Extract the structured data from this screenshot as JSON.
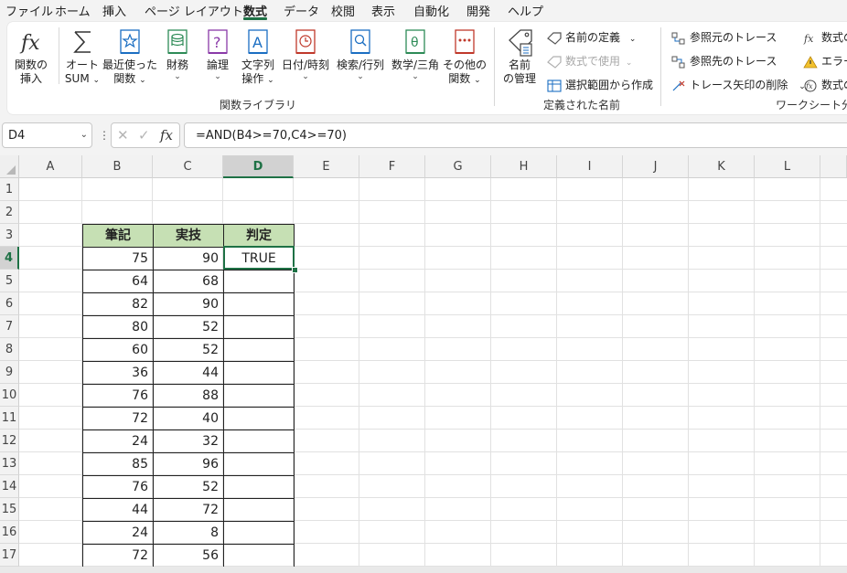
{
  "menu": {
    "items": [
      "ファイル",
      "ホーム",
      "挿入",
      "ページ レイアウト",
      "数式",
      "データ",
      "校閲",
      "表示",
      "自動化",
      "開発",
      "ヘルプ"
    ],
    "active_index": 4
  },
  "ribbon": {
    "function_library": {
      "buttons": [
        {
          "line1": "関数の",
          "line2": "挿入",
          "icon": "fx-icon"
        },
        {
          "line1": "オート",
          "line2": "SUM",
          "icon": "sigma-icon"
        },
        {
          "line1": "最近使った",
          "line2": "関数",
          "icon": "star-book-icon"
        },
        {
          "line1": "財務",
          "line2": "",
          "icon": "coins-book-icon"
        },
        {
          "line1": "論理",
          "line2": "",
          "icon": "question-book-icon"
        },
        {
          "line1": "文字列",
          "line2": "操作",
          "icon": "letter-a-book-icon"
        },
        {
          "line1": "日付/時刻",
          "line2": "",
          "icon": "clock-book-icon"
        },
        {
          "line1": "検索/行列",
          "line2": "",
          "icon": "magnifier-book-icon"
        },
        {
          "line1": "数学/三角",
          "line2": "",
          "icon": "theta-book-icon"
        },
        {
          "line1": "その他の",
          "line2": "関数",
          "icon": "more-book-icon"
        }
      ],
      "label": "関数ライブラリ"
    },
    "defined_names": {
      "name_manager": {
        "line1": "名前",
        "line2": "の管理"
      },
      "define_name": "名前の定義",
      "use_in_formula": "数式で使用",
      "create_from_selection": "選択範囲から作成",
      "label": "定義された名前"
    },
    "formula_auditing": {
      "trace_precedents": "参照元のトレース",
      "trace_dependents": "参照先のトレース",
      "remove_arrows": "トレース矢印の削除",
      "show_formulas": "数式の",
      "error_checking": "エラー",
      "evaluate_formula": "数式の",
      "label": "ワークシート分析"
    }
  },
  "formula_bar": {
    "name_box": "D4",
    "formula": "=AND(B4>=70,C4>=70)",
    "cancel_glyph": "✕",
    "enter_glyph": "✓",
    "fx_glyph": "fx"
  },
  "sheet": {
    "columns": [
      "A",
      "B",
      "C",
      "D",
      "E",
      "F",
      "G",
      "H",
      "I",
      "J",
      "K",
      "L"
    ],
    "rows": [
      "1",
      "2",
      "3",
      "4",
      "5",
      "6",
      "7",
      "8",
      "9",
      "10",
      "11",
      "12",
      "13",
      "14",
      "15",
      "16",
      "17"
    ],
    "selected_column": "D",
    "selected_row": "4",
    "table": {
      "headers": [
        "筆記",
        "実技",
        "判定"
      ],
      "rows": [
        [
          "75",
          "90",
          "TRUE"
        ],
        [
          "64",
          "68",
          ""
        ],
        [
          "82",
          "90",
          ""
        ],
        [
          "80",
          "52",
          ""
        ],
        [
          "60",
          "52",
          ""
        ],
        [
          "36",
          "44",
          ""
        ],
        [
          "76",
          "88",
          ""
        ],
        [
          "72",
          "40",
          ""
        ],
        [
          "24",
          "32",
          ""
        ],
        [
          "85",
          "96",
          ""
        ],
        [
          "76",
          "52",
          ""
        ],
        [
          "44",
          "72",
          ""
        ],
        [
          "24",
          "8",
          ""
        ],
        [
          "72",
          "56",
          ""
        ]
      ]
    }
  },
  "colors": {
    "accent": "#1e7145",
    "table_header_fill": "#c6e0b4"
  }
}
